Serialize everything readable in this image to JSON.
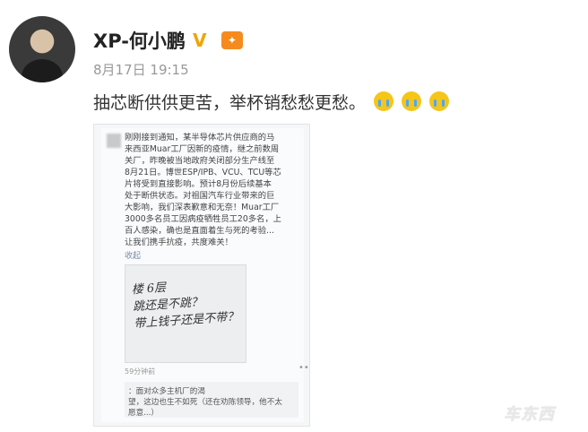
{
  "post": {
    "user_name": "XP-何小鹏",
    "time": "8月17日 19:15",
    "text": "抽芯断供供更苦，举杯销愁愁更愁。"
  },
  "icons": {
    "verified": "verified-v-icon",
    "vip": "vip-badge-icon",
    "emoji": "crying-emoji-icon"
  },
  "screenshot": {
    "message": "刚刚接到通知，某半导体芯片供应商的马\n来西亚Muar工厂因新的疫情，继之前数周\n关厂，昨晚被当地政府关闭部分生产线至\n8月21日。博世ESP/IPB、VCU、TCU等芯\n片将受到直接影响。预计8月份后续基本\n处于断供状态。对祖国汽车行业带来的巨\n大影响，我们深表歉意和无奈！Muar工厂\n3000多名员工因病疫牺牲员工20多名，上\n百人感染，确也是直面着生与死的考验...\n让我们携手抗疫，共度难关！",
    "collapse": "收起",
    "photo_text": "楼 6层\n跳还是不跳？\n带上钱子还是不带？",
    "time_ago": "59分钟前",
    "reply": "：面对众多主机厂的渴\n望，这边也生不如死（还在劝陈领导，他不太\n愿意...）"
  },
  "watermark": "车东西"
}
